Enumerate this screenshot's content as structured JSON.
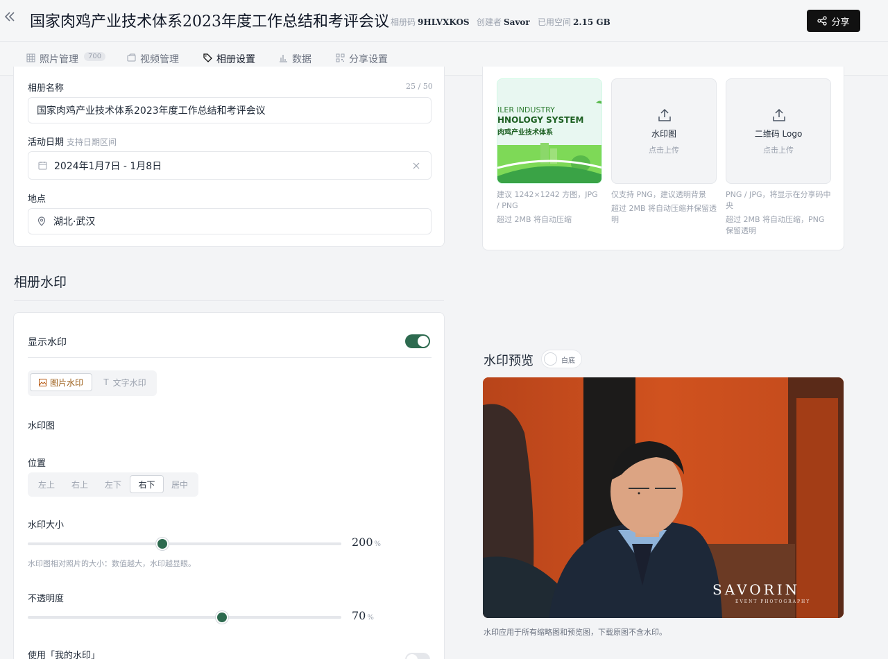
{
  "header": {
    "title": "国家肉鸡产业技术体系2023年度工作总结和考评会议",
    "album_code_label": "相册码",
    "album_code": "9HLVXKOS",
    "creator_label": "创建者",
    "creator": "Savor",
    "space_label": "已用空间",
    "space": "2.15 GB",
    "share_label": "分享"
  },
  "tabs": [
    {
      "label": "照片管理",
      "badge": "700",
      "icon": "grid-icon"
    },
    {
      "label": "视频管理",
      "icon": "video-icon"
    },
    {
      "label": "相册设置",
      "icon": "tag-icon",
      "active": true
    },
    {
      "label": "数据",
      "icon": "bar-chart-icon"
    },
    {
      "label": "分享设置",
      "icon": "qr-icon"
    }
  ],
  "basic": {
    "name_label": "相册名称",
    "name_counter": "25 / 50",
    "name_value": "国家肉鸡产业技术体系2023年度工作总结和考评会议",
    "date_label": "活动日期",
    "date_hint": "支持日期区间",
    "date_value": "2024年1月7日 - 1月8日",
    "location_label": "地点",
    "location_value": "湖北·武汉"
  },
  "uploads": {
    "cover_banner_line1": "ILER INDUSTRY",
    "cover_banner_line2": "HNOLOGY SYSTEM",
    "cover_banner_line3": "肉鸡产业技术体系",
    "cover_note1": "建议 1242×1242 方图，JPG / PNG",
    "cover_note2": "超过 2MB 将自动压缩",
    "watermark_title": "水印图",
    "watermark_sub": "点击上传",
    "watermark_note1": "仅支持 PNG，建议透明背景",
    "watermark_note2": "超过 2MB 将自动压缩并保留透明",
    "qr_title": "二维码 Logo",
    "qr_sub": "点击上传",
    "qr_note1": "PNG / JPG，将显示在分享码中央",
    "qr_note2": "超过 2MB 将自动压缩，PNG 保留透明"
  },
  "watermark": {
    "section_title": "相册水印",
    "show_label": "显示水印",
    "show_on": true,
    "type_image": "图片水印",
    "type_text": "文字水印",
    "image_label": "水印图",
    "position_label": "位置",
    "positions": [
      "左上",
      "右上",
      "左下",
      "右下",
      "居中"
    ],
    "position_selected": "右下",
    "size_label": "水印大小",
    "size_value": "200",
    "size_fraction": 0.43,
    "size_unit": "%",
    "size_hint": "水印图相对照片的大小：数值越大，水印越显眼。",
    "opacity_label": "不透明度",
    "opacity_value": "70",
    "opacity_fraction": 0.62,
    "opacity_unit": "%",
    "mine_label": "使用「我的水印」",
    "mine_on": false
  },
  "preview": {
    "title": "水印预览",
    "bg_toggle_label": "白底",
    "watermark_main": "SAVORIN",
    "watermark_sub": "EVENT PHOTOGRAPHY",
    "footer_note": "水印应用于所有缩略图和预览图，下载原图不含水印。"
  },
  "colors": {
    "accent_green": "#2d6a4f",
    "dark_button": "#111111"
  }
}
